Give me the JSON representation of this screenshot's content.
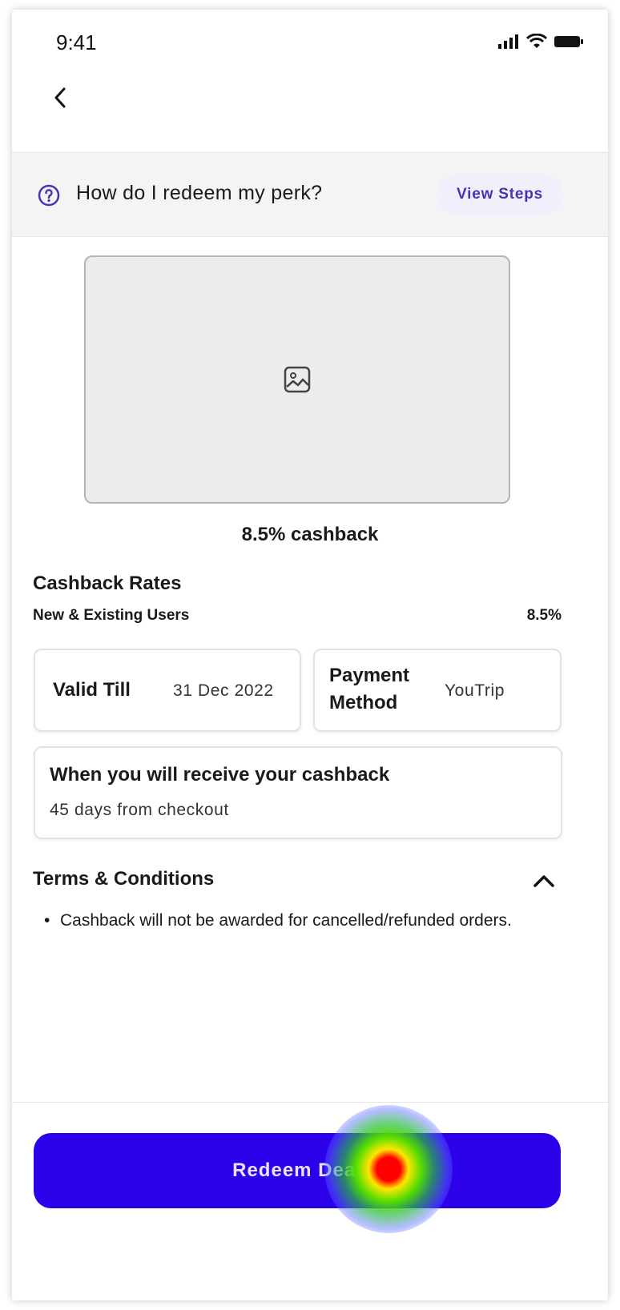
{
  "status_bar": {
    "time": "9:41"
  },
  "banner": {
    "question": "How do I redeem my perk?",
    "action": "View Steps"
  },
  "deal": {
    "title": "8.5% cashback"
  },
  "rates": {
    "title": "Cashback Rates",
    "label": "New & Existing Users",
    "value": "8.5%"
  },
  "validity": {
    "label": "Valid Till",
    "value": "31 Dec 2022"
  },
  "payment": {
    "label_line1": "Payment",
    "label_line2": "Method",
    "value": "YouTrip"
  },
  "receive": {
    "title": "When you will receive your cashback",
    "detail": "45 days from checkout"
  },
  "terms": {
    "title": "Terms & Conditions",
    "items": [
      "Cashback will not be awarded for cancelled/refunded orders."
    ]
  },
  "footer": {
    "button_label": "Redeem Deal"
  },
  "colors": {
    "primary": "#2d00ea",
    "accent_text": "#4a32b4"
  }
}
